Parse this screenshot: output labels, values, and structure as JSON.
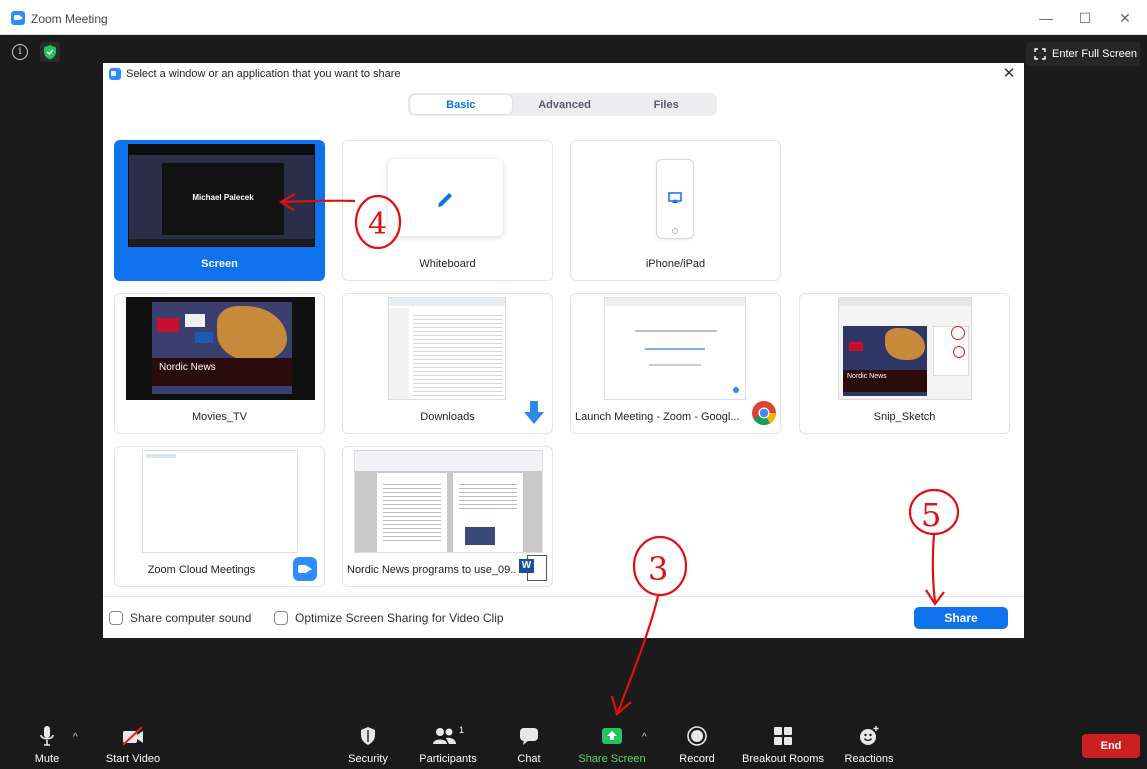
{
  "window": {
    "title": "Zoom Meeting"
  },
  "meeting": {
    "fullscreen_label": "Enter Full Screen"
  },
  "dialog": {
    "title": "Select a window or an application that you want to share",
    "tabs": [
      "Basic",
      "Advanced",
      "Files"
    ],
    "active_tab": "Basic",
    "cards": [
      {
        "label": "Screen",
        "selected": true,
        "thumb_name": "Michael Palecek"
      },
      {
        "label": "Whiteboard",
        "selected": false
      },
      {
        "label": "iPhone/iPad",
        "selected": false
      },
      {
        "label": "Movies_TV",
        "selected": false,
        "thumb_caption": "Nordic News"
      },
      {
        "label": "Downloads",
        "selected": false
      },
      {
        "label": "Launch Meeting - Zoom - Googl...",
        "selected": false
      },
      {
        "label": "Snip_Sketch",
        "selected": false,
        "thumb_caption": "Nordic News"
      },
      {
        "label": "Zoom Cloud Meetings",
        "selected": false
      },
      {
        "label": "Nordic News programs to use_09...",
        "selected": false
      }
    ],
    "footer": {
      "share_sound_label": "Share computer sound",
      "optimize_label": "Optimize Screen Sharing for Video Clip",
      "share_button": "Share"
    }
  },
  "toolbar": {
    "mute": "Mute",
    "start_video": "Start Video",
    "security": "Security",
    "participants": "Participants",
    "participants_count": "1",
    "chat": "Chat",
    "share_screen": "Share Screen",
    "record": "Record",
    "breakout_rooms": "Breakout Rooms",
    "reactions": "Reactions",
    "end": "End"
  },
  "annotations": [
    "3",
    "4",
    "5"
  ],
  "colors": {
    "accent": "#0e72ed",
    "end": "#cc1f1f",
    "share_green": "#5ed96d",
    "annotation": "#e01010"
  }
}
